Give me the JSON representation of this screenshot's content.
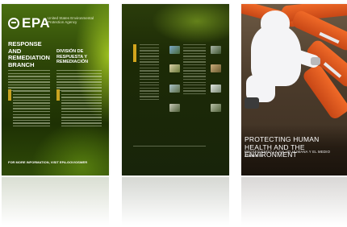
{
  "panel1": {
    "logo_text": "EPA",
    "agency_name": "United States Environmental Protection Agency",
    "heading_en": "RESPONSE AND REMEDIATION BRANCH",
    "heading_es": "DIVISIÓN DE RESPUESTA Y REMEDIACIÓN",
    "footer": "FOR MORE INFORMATION, VISIT EPA.GOV/OSWER"
  },
  "panel3": {
    "title": "PROTECTING HUMAN HEALTH AND THE ENVIRONMENT",
    "subtitle": "PROTEGIENDO LA SALUD HUMANA Y EL MEDIO AMBIENTE"
  }
}
